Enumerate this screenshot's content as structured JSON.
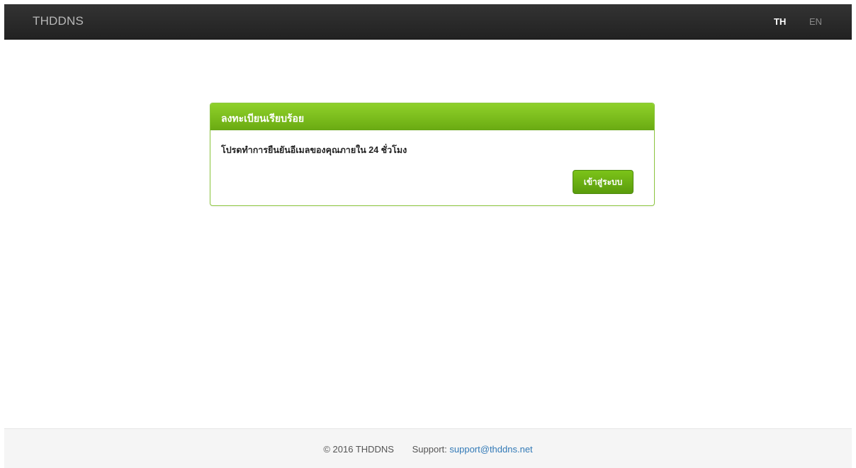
{
  "navbar": {
    "brand": "THDDNS",
    "languages": [
      {
        "label": "TH",
        "active": true
      },
      {
        "label": "EN",
        "active": false
      }
    ]
  },
  "panel": {
    "title": "ลงทะเบียนเรียบร้อย",
    "message": "โปรดทำการยืนยันอีเมลของคุณภายใน 24 ชั่วโมง",
    "login_button": "เข้าสู่ระบบ"
  },
  "footer": {
    "copyright": "© 2016 THDDNS",
    "support_label": "Support:",
    "support_email": "support@thddns.net"
  },
  "colors": {
    "navbar_bg": "#222222",
    "accent_green": "#7ab317",
    "link_blue": "#337ab7"
  }
}
